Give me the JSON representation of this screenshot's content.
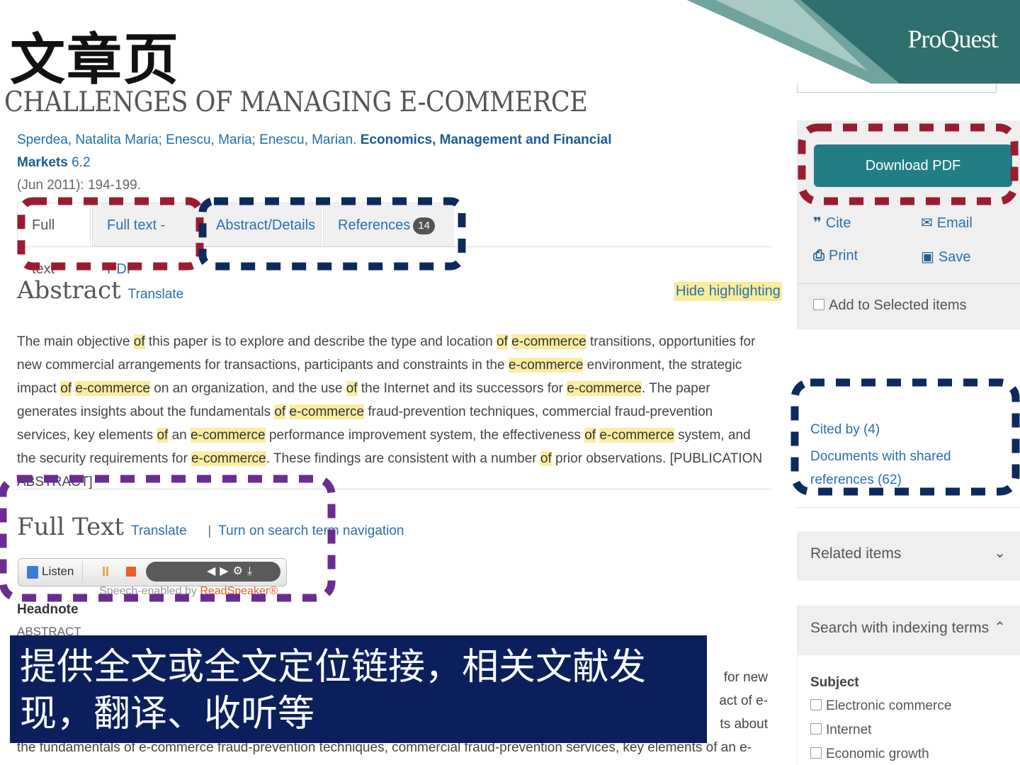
{
  "slide": {
    "title": "文章页",
    "caption": "提供全文或全文定位链接，相关文献发现，翻译、收听等"
  },
  "brand": {
    "logo_text": "ProQuest",
    "logo_dot": "."
  },
  "article": {
    "title": "CHALLENGES OF MANAGING E-COMMERCE",
    "authors": "Sperdea, Natalita Maria; Enescu, Maria; Enescu, Marian.",
    "journal": "Economics, Management and Financial Markets",
    "volume": "6.2",
    "date_pages": "(Jun 2011): 194-199."
  },
  "tabs": {
    "full_text": "Full text",
    "full_text_pdf": "Full text - PDF",
    "abstract_details": "Abstract/Details",
    "references": "References",
    "references_count": "14"
  },
  "abstract": {
    "heading": "Abstract",
    "translate": "Translate",
    "hide_highlighting": "Hide highlighting",
    "segments": [
      {
        "t": "The main objective ",
        "h": false
      },
      {
        "t": "of",
        "h": true
      },
      {
        "t": " this paper is to explore and describe the type and location ",
        "h": false
      },
      {
        "t": "of",
        "h": true
      },
      {
        "t": " ",
        "h": false
      },
      {
        "t": "e-commerce",
        "h": true
      },
      {
        "t": " transitions, opportunities for new commercial arrangements for transactions, participants and constraints in the ",
        "h": false
      },
      {
        "t": "e-commerce",
        "h": true
      },
      {
        "t": " environment, the strategic impact ",
        "h": false
      },
      {
        "t": "of",
        "h": true
      },
      {
        "t": " ",
        "h": false
      },
      {
        "t": "e-commerce",
        "h": true
      },
      {
        "t": " on an organization, and the use ",
        "h": false
      },
      {
        "t": "of",
        "h": true
      },
      {
        "t": " the Internet and its successors for ",
        "h": false
      },
      {
        "t": "e-commerce",
        "h": true
      },
      {
        "t": ". The paper generates insights about the fundamentals ",
        "h": false
      },
      {
        "t": "of",
        "h": true
      },
      {
        "t": " ",
        "h": false
      },
      {
        "t": "e-commerce",
        "h": true
      },
      {
        "t": " fraud-prevention techniques, commercial fraud-prevention services, key elements ",
        "h": false
      },
      {
        "t": "of",
        "h": true
      },
      {
        "t": " an ",
        "h": false
      },
      {
        "t": "e-commerce",
        "h": true
      },
      {
        "t": " performance improvement system, the effectiveness ",
        "h": false
      },
      {
        "t": "of",
        "h": true
      },
      {
        "t": " ",
        "h": false
      },
      {
        "t": "e-commerce",
        "h": true
      },
      {
        "t": " system, and the security requirements for ",
        "h": false
      },
      {
        "t": "e-commerce",
        "h": true
      },
      {
        "t": ". These findings are consistent with a number ",
        "h": false
      },
      {
        "t": "of",
        "h": true
      },
      {
        "t": " prior observations. [PUBLICATION ABSTRACT]",
        "h": false
      }
    ]
  },
  "full_text": {
    "heading": "Full Text",
    "translate": "Translate",
    "separator": "|",
    "search_nav": "Turn on search term navigation",
    "listen": "Listen",
    "pause": "II",
    "player_icons": "◀▶⚙⤓",
    "collapse": "«",
    "speech_credit_prefix": "Speech-enabled by ",
    "speech_credit_brand": "ReadSpeaker®",
    "headnote": "Headnote",
    "abstract_label": "ABSTRACT",
    "ghost_lines": [
      "for new",
      "act of e-",
      "ts about",
      "the fundamentals of e-commerce fraud-prevention techniques, commercial fraud-prevention services, key elements of an e-"
    ]
  },
  "sidebar": {
    "download_pdf": "Download PDF",
    "cite": "Cite",
    "email": "Email",
    "print": "Print",
    "save": "Save",
    "add_selected": "Add to Selected items",
    "cited_by": "Cited by (4)",
    "shared_refs": "Documents with shared references (62)",
    "related_items": "Related items",
    "search_indexing": "Search with indexing terms",
    "subject_label": "Subject",
    "subjects": [
      "Electronic commerce",
      "Internet",
      "Economic growth"
    ]
  },
  "colors": {
    "teal": "#227e86",
    "link_blue": "#2a6fb0",
    "highlight": "#fbec9f",
    "caption_bg": "#0a1f5c",
    "annot_red": "#9b1c31",
    "annot_navy": "#0d2a5c",
    "annot_purple": "#6a2c91"
  }
}
